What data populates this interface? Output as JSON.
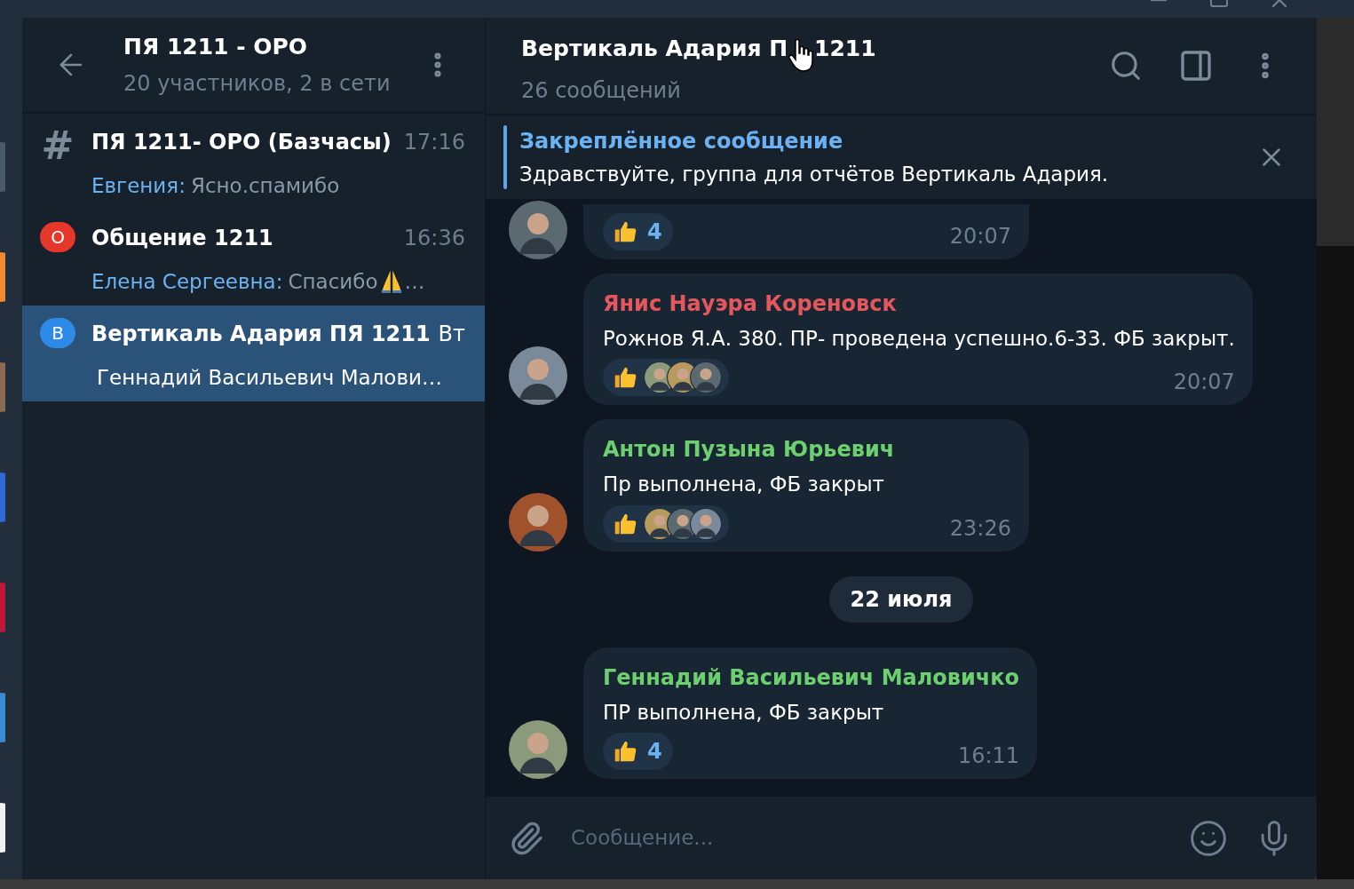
{
  "group_header": {
    "title": "ПЯ 1211 - ОРО",
    "subtitle": "20 участников, 2 в сети"
  },
  "chats": [
    {
      "avatar": {
        "kind": "hash",
        "symbol": "#"
      },
      "name": "ПЯ 1211- ОРО (Базчасы)",
      "time": "17:16",
      "sender": "Евгения:",
      "preview": "Ясно.спамибо",
      "selected": false
    },
    {
      "avatar": {
        "kind": "bubble",
        "letter": "О",
        "color": "#e5382b"
      },
      "name": "Общение 1211",
      "time": "16:36",
      "sender": "Елена Сергеевна:",
      "preview": "Спасибо",
      "emoji": {
        "kind": "praying-hands"
      },
      "suffix": "…",
      "selected": false
    },
    {
      "avatar": {
        "kind": "bubble",
        "letter": "В",
        "color": "#2d8ae6"
      },
      "name": "Вертикаль Адария ПЯ 1211",
      "time": "Вт",
      "preview": "Геннадий Васильевич Малови…",
      "selected": true
    }
  ],
  "chat_header": {
    "title_start": "Вертикаль Адария П",
    "title_end": "1211",
    "subtitle": "26 сообщений"
  },
  "pinned": {
    "label": "Закреплённое сообщение",
    "text": "Здравствуйте, группа для отчётов Вертикаль Адария."
  },
  "messages": [
    {
      "kind": "message",
      "partial": true,
      "reaction": {
        "kind": "count",
        "count": "4"
      },
      "time": "20:07"
    },
    {
      "kind": "message",
      "partial": false,
      "author": {
        "name": "Янис Науэра Кореновск",
        "color": "#e4575c"
      },
      "text": "Рожнов Я.А. 380. ПР- проведена успешно.6-33. ФБ закрыт.",
      "reaction": {
        "kind": "avatars"
      },
      "time": "20:07"
    },
    {
      "kind": "message",
      "partial": false,
      "author": {
        "name": "Антон Пузына Юрьевич",
        "color": "#6dd06f"
      },
      "text": "Пр выполнена, ФБ закрыт",
      "reaction": {
        "kind": "avatars"
      },
      "time": "23:26"
    },
    {
      "kind": "date",
      "text": "22 июля"
    },
    {
      "kind": "message",
      "partial": false,
      "author": {
        "name": "Геннадий Васильевич Маловичко",
        "color": "#6dd06f"
      },
      "text": "ПР выполнена, ФБ закрыт",
      "reaction": {
        "kind": "count",
        "count": "4"
      },
      "time": "16:11"
    }
  ],
  "composer": {
    "placeholder": "Сообщение..."
  }
}
